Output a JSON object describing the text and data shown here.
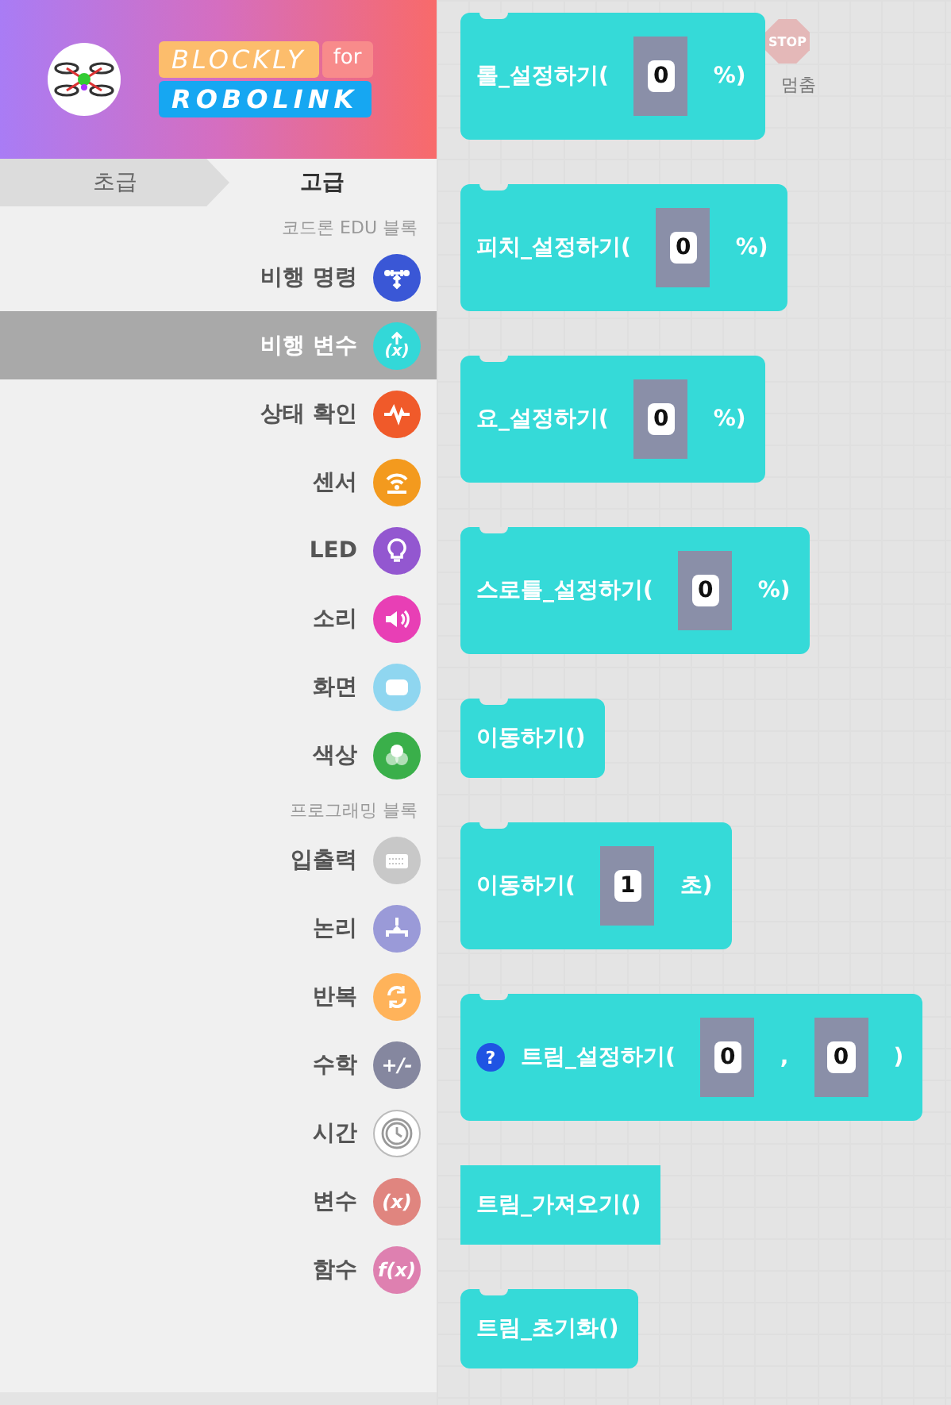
{
  "logo": {
    "line1": "BLOCKLY",
    "tag": "for",
    "line2": "ROBOLINK"
  },
  "tabs": [
    {
      "label": "초급",
      "selected": false
    },
    {
      "label": "고급",
      "selected": true
    }
  ],
  "sections": [
    {
      "title": "코드론 EDU 블록",
      "items": [
        {
          "label": "비행 명령",
          "color": "#3a57d6",
          "selected": false
        },
        {
          "label": "비행 변수",
          "color": "#33d8d8",
          "selected": true,
          "glyph": "(x)"
        },
        {
          "label": "상태 확인",
          "color": "#f05a2a",
          "selected": false
        },
        {
          "label": "센서",
          "color": "#f39a1e",
          "selected": false
        },
        {
          "label": "LED",
          "color": "#9357d0",
          "selected": false
        },
        {
          "label": "소리",
          "color": "#e83fb5",
          "selected": false
        },
        {
          "label": "화면",
          "color": "#8fd6f0",
          "selected": false
        },
        {
          "label": "색상",
          "color": "#3aaf4a",
          "selected": false
        }
      ]
    },
    {
      "title": "프로그래밍 블록",
      "items": [
        {
          "label": "입출력",
          "color": "#c8c8c8",
          "selected": false
        },
        {
          "label": "논리",
          "color": "#9a9ad8",
          "selected": false
        },
        {
          "label": "반복",
          "color": "#ffb35a",
          "selected": false
        },
        {
          "label": "수학",
          "color": "#85879f",
          "selected": false,
          "glyph": "+/-"
        },
        {
          "label": "시간",
          "color": "#ffffff",
          "selected": false
        },
        {
          "label": "변수",
          "color": "#e0857f",
          "selected": false,
          "glyph": "(x)"
        },
        {
          "label": "함수",
          "color": "#de80b0",
          "selected": false,
          "glyph": "f(x)"
        }
      ]
    }
  ],
  "stop_button": {
    "sign": "STOP",
    "label": "멈춤"
  },
  "blocks": [
    {
      "kind": "statement",
      "parts": [
        {
          "kind": "text",
          "text": "롤_설정하기("
        },
        {
          "kind": "input",
          "value": "0"
        },
        {
          "kind": "text",
          "text": "%)"
        }
      ]
    },
    {
      "kind": "statement",
      "parts": [
        {
          "kind": "text",
          "text": "피치_설정하기("
        },
        {
          "kind": "input",
          "value": "0"
        },
        {
          "kind": "text",
          "text": "%)"
        }
      ]
    },
    {
      "kind": "statement",
      "parts": [
        {
          "kind": "text",
          "text": "요_설정하기("
        },
        {
          "kind": "input",
          "value": "0"
        },
        {
          "kind": "text",
          "text": "%)"
        }
      ]
    },
    {
      "kind": "statement",
      "parts": [
        {
          "kind": "text",
          "text": "스로틀_설정하기("
        },
        {
          "kind": "input",
          "value": "0"
        },
        {
          "kind": "text",
          "text": "%)"
        }
      ]
    },
    {
      "kind": "statement",
      "parts": [
        {
          "kind": "text",
          "text": "이동하기()"
        }
      ]
    },
    {
      "kind": "statement",
      "parts": [
        {
          "kind": "text",
          "text": "이동하기("
        },
        {
          "kind": "input",
          "value": "1"
        },
        {
          "kind": "text",
          "text": "초)"
        }
      ]
    },
    {
      "kind": "statement",
      "parts": [
        {
          "kind": "help",
          "text": "?"
        },
        {
          "kind": "text",
          "text": "트림_설정하기("
        },
        {
          "kind": "input",
          "value": "0"
        },
        {
          "kind": "text",
          "text": ","
        },
        {
          "kind": "input",
          "value": "0"
        },
        {
          "kind": "text",
          "text": ")"
        }
      ]
    },
    {
      "kind": "value",
      "parts": [
        {
          "kind": "text",
          "text": "트림_가져오기()"
        }
      ]
    },
    {
      "kind": "statement",
      "parts": [
        {
          "kind": "text",
          "text": "트림_초기화()"
        }
      ]
    }
  ]
}
